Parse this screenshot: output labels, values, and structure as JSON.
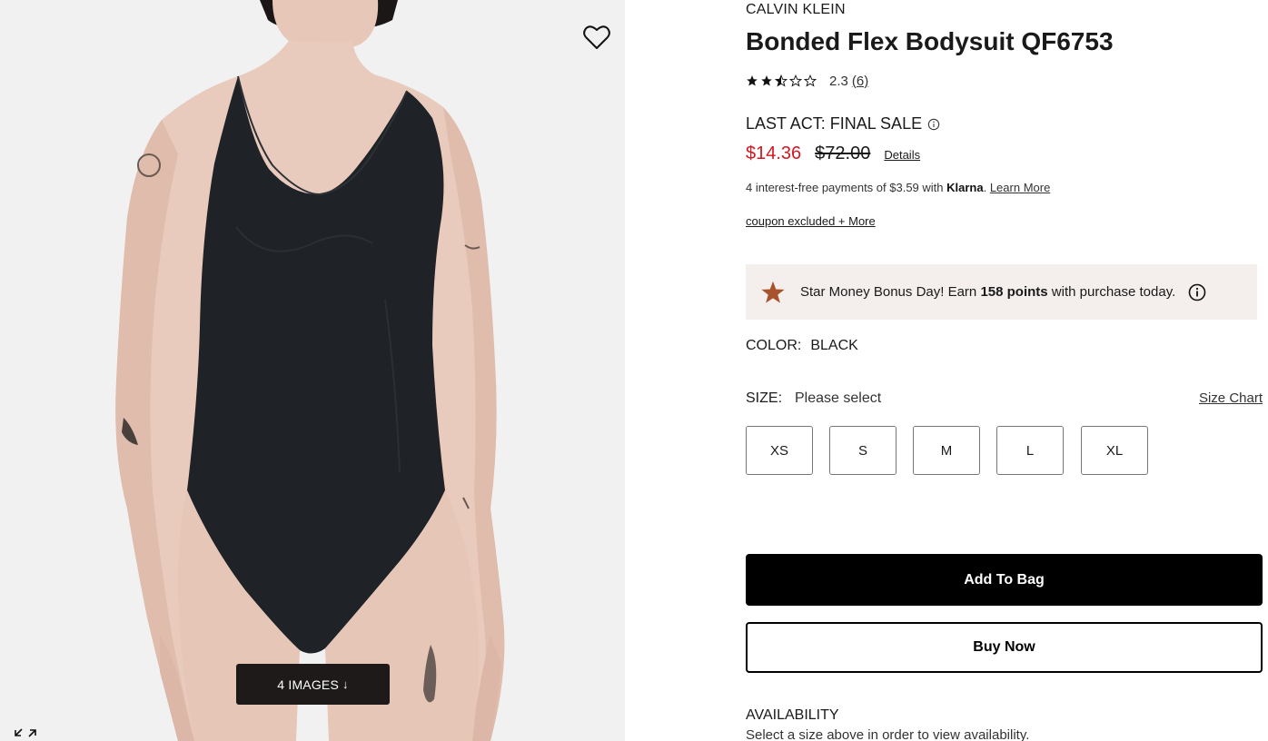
{
  "media": {
    "images_button_label": "4 IMAGES",
    "images_button_arrow": "↓",
    "wishlist_icon": "heart-outline-icon",
    "expand_icon": "expand-arrows-icon"
  },
  "product": {
    "brand": "CALVIN KLEIN",
    "title": "Bonded Flex Bodysuit QF6753",
    "rating": {
      "value": "2.3",
      "count": "(6)",
      "stars_out_of_5": 2.3
    },
    "sale_label": "LAST ACT: FINAL SALE",
    "price": {
      "sale": "$14.36",
      "original": "$72.00",
      "details_link": "Details"
    },
    "klarna": {
      "prefix": "4 interest-free payments of $3.59 with ",
      "brand": "Klarna",
      "suffix": ". ",
      "link": "Learn More"
    },
    "coupon_link": "coupon excluded + More",
    "promo": {
      "prefix": "Star Money Bonus Day! Earn ",
      "points": "158 points",
      "suffix": " with purchase today."
    },
    "color": {
      "label": "COLOR:",
      "value": "BLACK"
    },
    "size": {
      "label": "SIZE:",
      "value": "Please select",
      "chart_link": "Size Chart",
      "options": [
        "XS",
        "S",
        "M",
        "L",
        "XL"
      ]
    },
    "add_to_bag": "Add To Bag",
    "buy_now": "Buy Now",
    "availability": {
      "title": "AVAILABILITY",
      "text": "Select a size above in order to view availability."
    }
  },
  "colors": {
    "sale_red": "#d4161f",
    "promo_bg": "#f4efed",
    "promo_star": "#a9532e",
    "images_button_bg": "#1e1a19"
  }
}
